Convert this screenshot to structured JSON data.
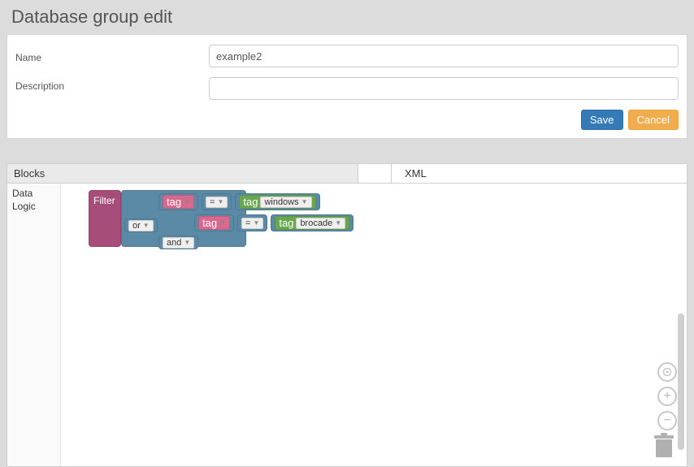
{
  "page_title": "Database group edit",
  "form": {
    "name_label": "Name",
    "name_value": "example2",
    "description_label": "Description",
    "description_value": ""
  },
  "actions": {
    "save": "Save",
    "cancel": "Cancel"
  },
  "tabs": {
    "blocks": "Blocks",
    "xml": "XML",
    "active": "blocks"
  },
  "toolbox": {
    "categories": [
      "Data",
      "Logic"
    ]
  },
  "blocks": {
    "filter_label": "Filter",
    "or_label": "or",
    "and_label": "and",
    "tag_label": "tag",
    "eq_label": "=",
    "row1_value": "windows",
    "row2_value": "brocade"
  },
  "controls": {
    "center": "⊙",
    "zoom_in": "+",
    "zoom_out": "−"
  }
}
